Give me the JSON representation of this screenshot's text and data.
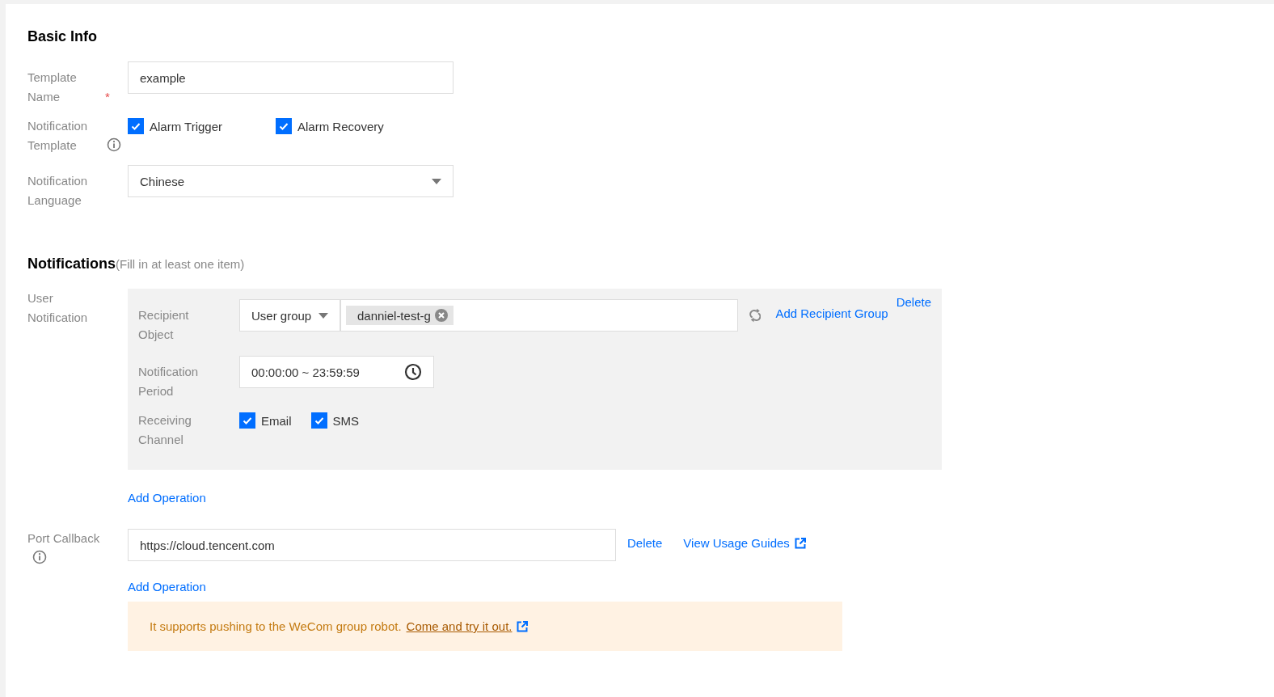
{
  "basic_info": {
    "title": "Basic Info",
    "fields": [
      {
        "kind": "input",
        "label": "Template Name",
        "required_mark": "*",
        "value": "example"
      },
      {
        "kind": "checkboxes",
        "label": "Notification Template",
        "info": true,
        "options": [
          {
            "label": "Alarm Trigger",
            "checked": true
          },
          {
            "label": "Alarm Recovery",
            "checked": true
          }
        ]
      },
      {
        "kind": "select",
        "label": "Notification Language",
        "value": "Chinese"
      }
    ]
  },
  "notifications": {
    "title": "Notifications",
    "hint": "(Fill in at least one item)",
    "user_notification": {
      "label": "User Notification",
      "recipient_label": "Recipient Object",
      "recipient_type": "User group",
      "tags": [
        "danniel-test-g"
      ],
      "add_group_link": "Add Recipient Group",
      "delete_link": "Delete",
      "period_label": "Notification Period",
      "period_value": "00:00:00 ~ 23:59:59",
      "channel_label": "Receiving Channel",
      "channels": [
        {
          "label": "Email",
          "checked": true
        },
        {
          "label": "SMS",
          "checked": true
        }
      ],
      "add_operation": "Add Operation"
    },
    "port_callback": {
      "label": "Port Callback",
      "url": "https://cloud.tencent.com",
      "delete_link": "Delete",
      "guide_link": "View Usage Guides",
      "add_operation": "Add Operation"
    },
    "notice": {
      "text": "It supports pushing to the WeCom group robot.",
      "link": "Come and try it out."
    }
  }
}
